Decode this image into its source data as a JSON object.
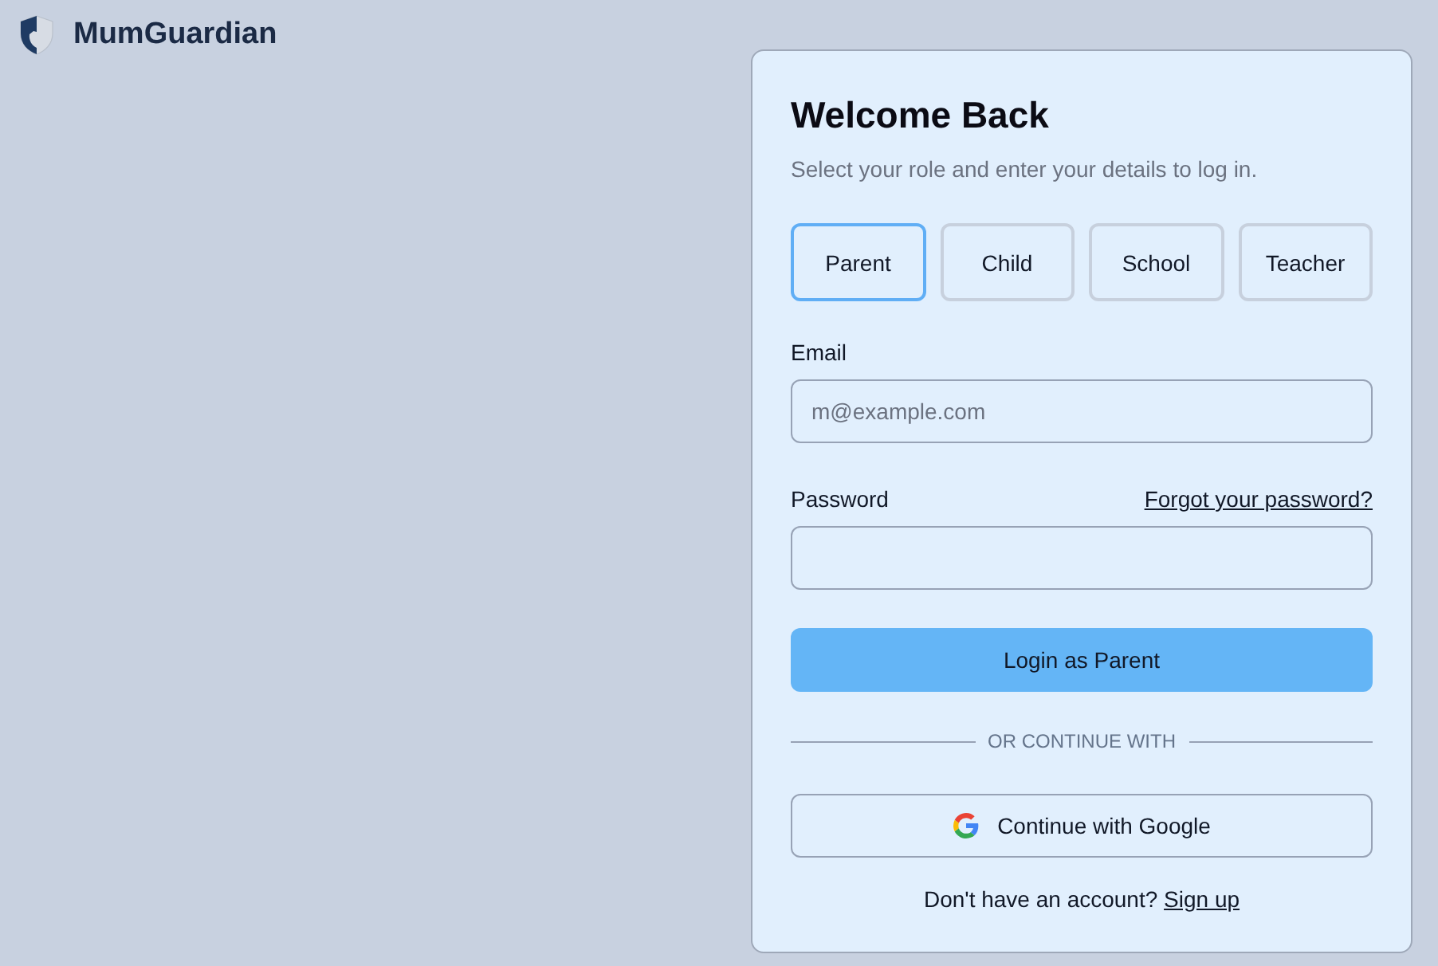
{
  "app": {
    "name": "MumGuardian"
  },
  "login_card": {
    "title": "Welcome Back",
    "subtitle": "Select your role and enter your details to log in.",
    "roles": [
      {
        "label": "Parent",
        "selected": true
      },
      {
        "label": "Child",
        "selected": false
      },
      {
        "label": "School",
        "selected": false
      },
      {
        "label": "Teacher",
        "selected": false
      }
    ],
    "fields": [
      {
        "label": "Email",
        "placeholder": "m@example.com"
      },
      {
        "label": "Password",
        "link": "Forgot your password?"
      }
    ],
    "login_button": "Login as Parent",
    "divider": "OR CONTINUE WITH",
    "google_button": "Continue with Google",
    "signup": {
      "text": "Don't have an account?",
      "link": "Sign up"
    }
  }
}
